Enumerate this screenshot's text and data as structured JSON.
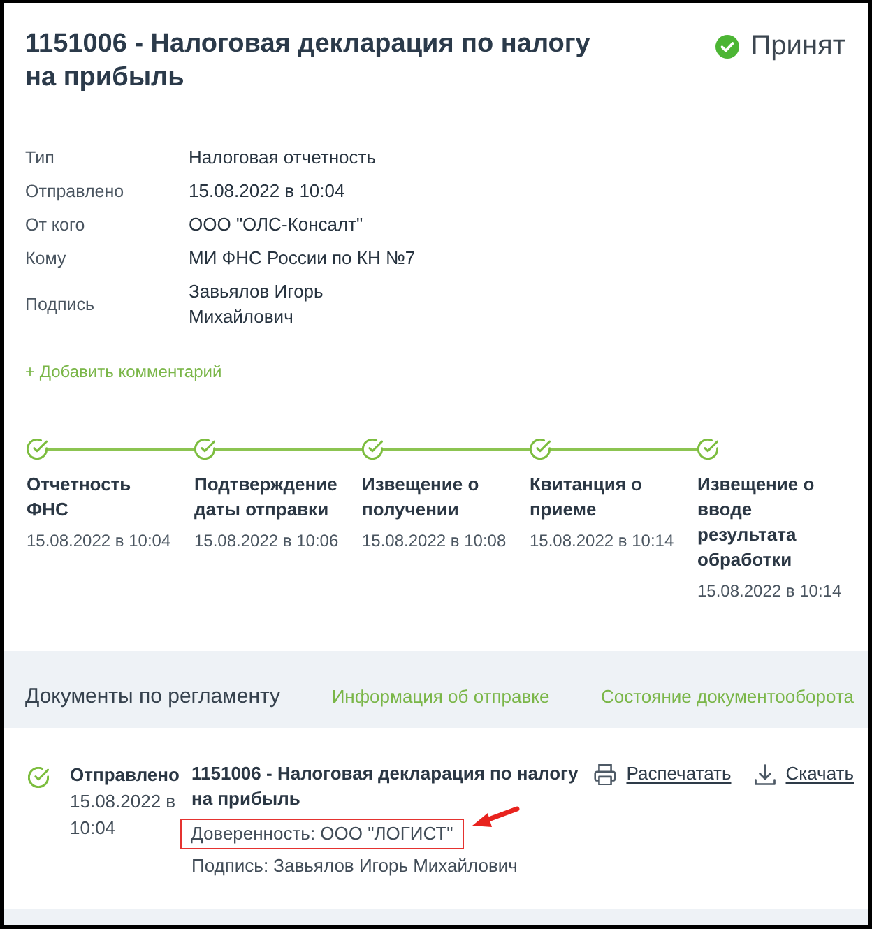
{
  "header": {
    "title": "1151006 - Налоговая декларация по налогу на прибыль",
    "status": {
      "label": "Принят",
      "kind": "accepted"
    }
  },
  "details": [
    {
      "label": "Тип",
      "value": "Налоговая отчетность"
    },
    {
      "label": "Отправлено",
      "value": "15.08.2022 в 10:04"
    },
    {
      "label": "От кого",
      "value": "ООО \"ОЛС-Консалт\""
    },
    {
      "label": "Кому",
      "value": "МИ ФНС России по КН №7"
    },
    {
      "label": "Подпись",
      "value": "Завьялов Игорь Михайлович"
    }
  ],
  "add_comment": "+ Добавить комментарий",
  "timeline": [
    {
      "title": "Отчетность ФНС",
      "date": "15.08.2022 в 10:04",
      "done": true
    },
    {
      "title": "Подтверждение даты отправки",
      "date": "15.08.2022 в 10:06",
      "done": true
    },
    {
      "title": "Извещение о получении",
      "date": "15.08.2022 в 10:08",
      "done": true
    },
    {
      "title": "Квитанция о приеме",
      "date": "15.08.2022 в 10:14",
      "done": true
    },
    {
      "title": "Извещение о вводе результата обработки",
      "date": "15.08.2022 в 10:14",
      "done": true
    }
  ],
  "documents_section": {
    "title": "Документы по регламенту",
    "links": [
      "Информация об отправке",
      "Состояние документооборота"
    ]
  },
  "documents": [
    {
      "status": "Отправлено",
      "done": true,
      "date": "15.08.2022 в 10:04",
      "title": "1151006 - Налоговая декларация по налогу на прибыль",
      "lines": [
        {
          "text": "Доверенность: ООО \"ЛОГИСТ\"",
          "highlighted": true
        },
        {
          "text": "Подпись: Завьялов Игорь Михайлович",
          "highlighted": false
        }
      ],
      "actions": [
        {
          "label": "Распечатать",
          "kind": "print"
        },
        {
          "label": "Скачать",
          "kind": "download"
        }
      ]
    }
  ]
}
